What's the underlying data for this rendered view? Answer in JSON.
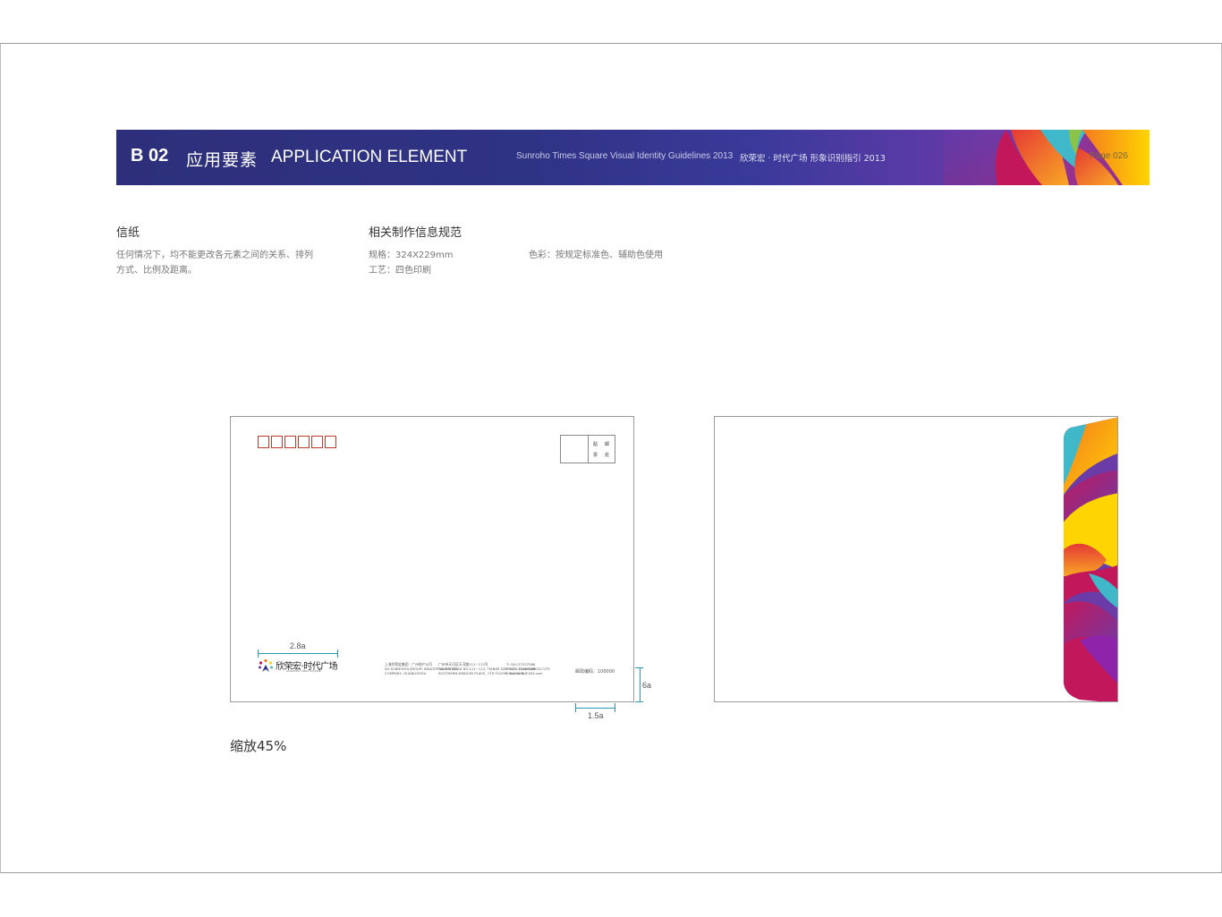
{
  "header": {
    "code": "B 02",
    "title_cn": "应用要素",
    "title_en": "APPLICATION ELEMENT",
    "subtitle_en": "Sunroho Times Square Visual Identity Guidelines 2013",
    "subtitle_cn": "欣荣宏 · 时代广场 形象识别指引  2013",
    "page": "Page 026",
    "colors": {
      "navy": "#2d2f7a",
      "purple": "#6b3ba8",
      "magenta": "#c2185b",
      "orange": "#f47b20",
      "yellow": "#ffd400",
      "teal": "#3fb8c9"
    }
  },
  "left_section": {
    "title": "信纸",
    "lines": [
      "任何情况下，均不能更改各元素之间的关系、排列",
      "方式、比例及距离。"
    ]
  },
  "info_section": {
    "title": "相关制作信息规范",
    "spec": "规格：324X229mm",
    "process": "工艺：四色印刷",
    "color": "色彩：按规定标准色、辅助色使用"
  },
  "envelope_front": {
    "postcode_box_count": 6,
    "stamp_chars": [
      "贴",
      "邮",
      "票",
      "处"
    ],
    "logo_name": "欣荣宏·时代广场",
    "logo_sub": "SUNROHO TIMES SQUARE",
    "address_block_1": [
      "上海欣荣宏集团 · 广州地产公司",
      "SH SUNROHO(GROUP) INDUSTRIAL ESTATE",
      "COMPANY, GUANGZHOU"
    ],
    "address_block_2": [
      "广州市天河区天河路111~113号",
      "TIANHE ROAD NO.111~113, TIANHE DISTRICT, GUANGZHOU CITY",
      "SOUTHERN DRAGON PLACE, 1TH FLOOR, BLOCK B"
    ],
    "address_block_3": [
      "T: 020-37537566",
      "F: 020-37537566",
      "E: sunroho@163.com"
    ],
    "postcode_label": "邮政编码：100000",
    "dim_top": "2.8a",
    "dim_right": "6a",
    "dim_bottom": "1.5a"
  },
  "scale_note": "缩放45%"
}
